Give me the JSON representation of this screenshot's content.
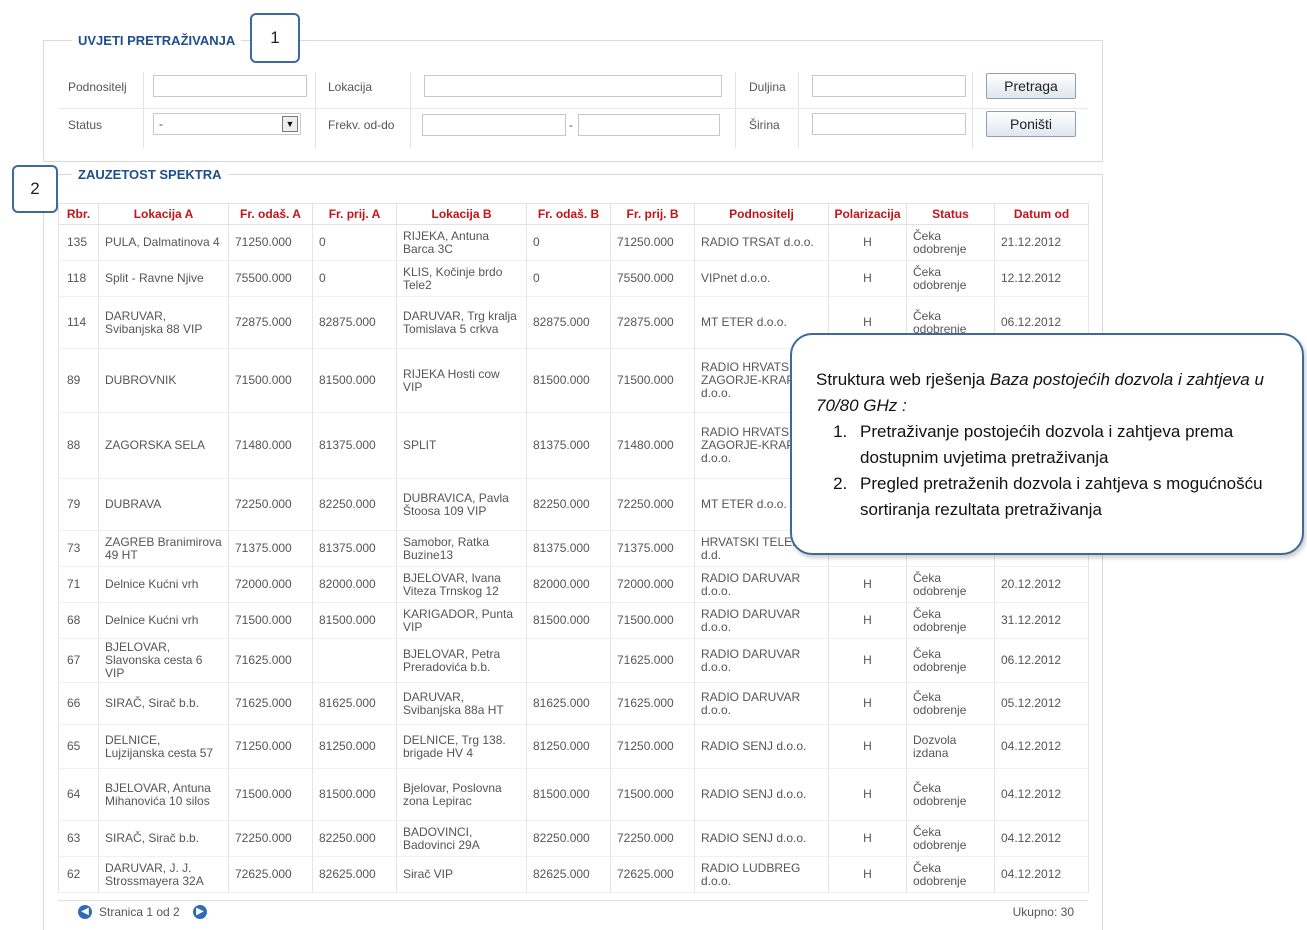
{
  "search": {
    "title": "UVJETI PRETRAŽIVANJA",
    "callout_number": "1",
    "labels": {
      "podnositelj": "Podnositelj",
      "lokacija": "Lokacija",
      "duljina": "Duljina",
      "status": "Status",
      "frekv": "Frekv. od-do",
      "sirina": "Širina"
    },
    "status_value": "-",
    "range_separator": "-",
    "search_button": "Pretraga",
    "reset_button": "Poništi"
  },
  "results": {
    "title": "ZAUZETOST SPEKTRA",
    "callout_number": "2",
    "columns": [
      "Rbr.",
      "Lokacija A",
      "Fr. odaš. A",
      "Fr. prij. A",
      "Lokacija B",
      "Fr. odaš. B",
      "Fr. prij. B",
      "Podnositelj",
      "Polarizacija",
      "Status",
      "Datum od"
    ],
    "rows": [
      [
        "135",
        "PULA, Dalmatinova 4",
        "71250.000",
        "0",
        "RIJEKA, Antuna Barca 3C",
        "0",
        "71250.000",
        "RADIO TRSAT d.o.o.",
        "H",
        "Čeka odobrenje",
        "21.12.2012"
      ],
      [
        "118",
        "Split - Ravne Njive",
        "75500.000",
        "0",
        "KLIS, Kočinje brdo Tele2",
        "0",
        "75500.000",
        "VIPnet d.o.o.",
        "H",
        "Čeka odobrenje",
        "12.12.2012"
      ],
      [
        "114",
        "DARUVAR, Svibanjska 88 VIP",
        "72875.000",
        "82875.000",
        "DARUVAR, Trg kralja Tomislava 5 crkva",
        "82875.000",
        "72875.000",
        "MT ETER d.o.o.",
        "H",
        "Čeka odobrenje",
        "06.12.2012"
      ],
      [
        "89",
        "DUBROVNIK",
        "71500.000",
        "81500.000",
        "RIJEKA Hosti cow VIP",
        "81500.000",
        "71500.000",
        "RADIO HRVATSKO ZAGORJE-KRAPINA d.o.o.",
        "",
        "",
        ""
      ],
      [
        "88",
        "ZAGORSKA SELA",
        "71480.000",
        "81375.000",
        "SPLIT",
        "81375.000",
        "71480.000",
        "RADIO HRVATSKO ZAGORJE-KRAPINA d.o.o.",
        "",
        "",
        ""
      ],
      [
        "79",
        "DUBRAVA",
        "72250.000",
        "82250.000",
        "DUBRAVICA, Pavla Štoosa 109 VIP",
        "82250.000",
        "72250.000",
        "MT ETER d.o.o.",
        "",
        "",
        ""
      ],
      [
        "73",
        "ZAGREB Branimirova 49 HT",
        "71375.000",
        "81375.000",
        "Samobor, Ratka Buzine13",
        "81375.000",
        "71375.000",
        "HRVATSKI TELEKOM d.d.",
        "",
        "",
        ""
      ],
      [
        "71",
        "Delnice Kućni vrh",
        "72000.000",
        "82000.000",
        "BJELOVAR, Ivana Viteza Trnskog 12",
        "82000.000",
        "72000.000",
        "RADIO DARUVAR d.o.o.",
        "H",
        "Čeka odobrenje",
        "20.12.2012"
      ],
      [
        "68",
        "Delnice Kućni vrh",
        "71500.000",
        "81500.000",
        "KARIGADOR, Punta VIP",
        "81500.000",
        "71500.000",
        "RADIO DARUVAR d.o.o.",
        "H",
        "Čeka odobrenje",
        "31.12.2012"
      ],
      [
        "67",
        "BJELOVAR, Slavonska cesta 6 VIP",
        "71625.000",
        "",
        "BJELOVAR, Petra Preradovića b.b.",
        "",
        "71625.000",
        "RADIO DARUVAR d.o.o.",
        "H",
        "Čeka odobrenje",
        "06.12.2012"
      ],
      [
        "66",
        "SIRAČ, Sirač b.b.",
        "71625.000",
        "81625.000",
        "DARUVAR, Svibanjska 88a HT",
        "81625.000",
        "71625.000",
        "RADIO DARUVAR d.o.o.",
        "H",
        "Čeka odobrenje",
        "05.12.2012"
      ],
      [
        "65",
        "DELNICE, Lujzijanska cesta 57",
        "71250.000",
        "81250.000",
        "DELNICE, Trg 138. brigade HV 4",
        "81250.000",
        "71250.000",
        "RADIO SENJ d.o.o.",
        "H",
        "Dozvola izdana",
        "04.12.2012"
      ],
      [
        "64",
        "BJELOVAR, Antuna Mihanovića 10 silos",
        "71500.000",
        "81500.000",
        "Bjelovar, Poslovna zona Lepirac",
        "81500.000",
        "71500.000",
        "RADIO SENJ d.o.o.",
        "H",
        "Čeka odobrenje",
        "04.12.2012"
      ],
      [
        "63",
        "SIRAČ, Sirač b.b.",
        "72250.000",
        "82250.000",
        "BADOVINCI, Badovinci 29A",
        "82250.000",
        "72250.000",
        "RADIO SENJ d.o.o.",
        "H",
        "Čeka odobrenje",
        "04.12.2012"
      ],
      [
        "62",
        "DARUVAR, J. J. Strossmayera 32A",
        "72625.000",
        "82625.000",
        "Sirač VIP",
        "82625.000",
        "72625.000",
        "RADIO LUDBREG d.o.o.",
        "H",
        "Čeka odobrenje",
        "04.12.2012"
      ]
    ],
    "pager": {
      "page_text": "Stranica 1 od 2",
      "total_text": "Ukupno: 30",
      "prev_icon": "arrow-left-circle-icon",
      "next_icon": "arrow-right-circle-icon"
    }
  },
  "note": {
    "intro_plain": "Struktura web rješenja ",
    "intro_italic": "Baza postojećih dozvola i zahtjeva u 70/80 GHz :",
    "items": [
      "Pretraživanje postojećih dozvola i zahtjeva prema dostupnim uvjetima pretraživanja",
      "Pregled pretraženih dozvola i zahtjeva s mogućnošću sortiranja rezultata pretraživanja"
    ]
  },
  "colors": {
    "section_title": "#1f4e8c",
    "table_header": "#c0151a",
    "callout_border": "#3d6a9b",
    "pager_icon": "#2e6db4"
  }
}
